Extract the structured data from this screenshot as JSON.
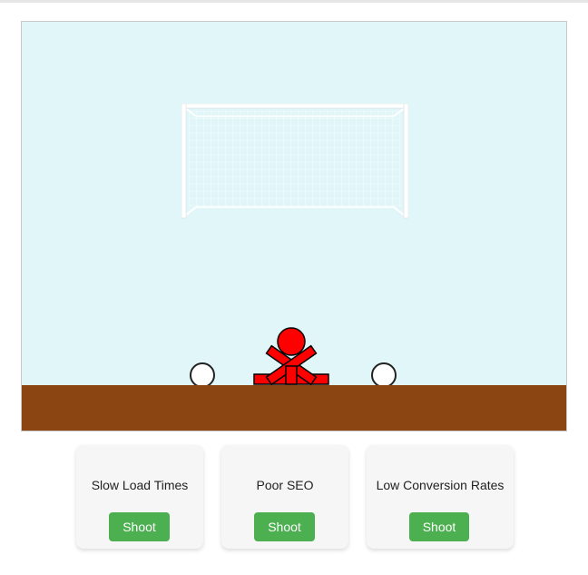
{
  "game": {
    "colors": {
      "sky": "#e0f6f8",
      "ground": "#8b4513",
      "goalkeeper": "#ff0000",
      "ball": "#ffffff",
      "button": "#4caf50"
    },
    "balls": 2,
    "goalkeeper_pose": "crossed-arms"
  },
  "cards": [
    {
      "label": "Slow Load Times",
      "button": "Shoot"
    },
    {
      "label": "Poor SEO",
      "button": "Shoot"
    },
    {
      "label": "Low Conversion Rates",
      "button": "Shoot"
    }
  ]
}
